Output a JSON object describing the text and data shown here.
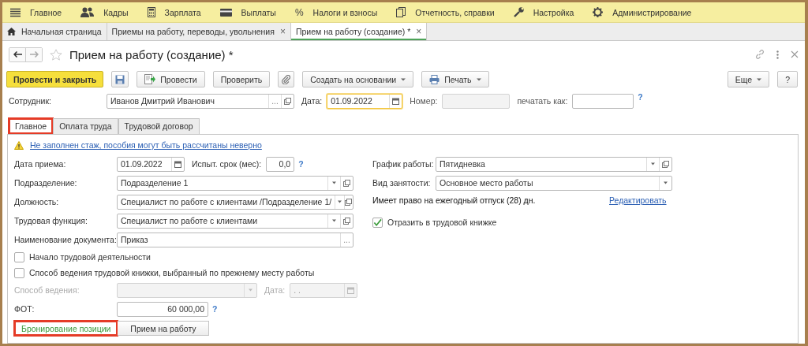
{
  "menu": [
    {
      "kind": "menu",
      "label": "Главное"
    },
    {
      "kind": "people",
      "label": "Кадры"
    },
    {
      "kind": "calculator",
      "label": "Зарплата"
    },
    {
      "kind": "card",
      "label": "Выплаты"
    },
    {
      "kind": "glyph",
      "glyph": "%",
      "label": "Налоги и взносы"
    },
    {
      "kind": "docs",
      "label": "Отчетность, справки"
    },
    {
      "kind": "wrench",
      "label": "Настройка"
    },
    {
      "kind": "gear",
      "label": "Администрирование"
    }
  ],
  "open_tabs": [
    {
      "kind": "home",
      "label": "Начальная страница",
      "selected": false,
      "closable": false
    },
    {
      "kind": "page",
      "label": "Приемы на работу, переводы, увольнения",
      "selected": false,
      "closable": true,
      "close": "×"
    },
    {
      "kind": "page",
      "label": "Прием на работу (создание) *",
      "selected": true,
      "closable": true,
      "close": "×"
    }
  ],
  "form": {
    "title": "Прием на работу (создание) *"
  },
  "toolbar": [
    {
      "kind": "primary",
      "label": "Провести и закрыть"
    },
    {
      "kind": "save"
    },
    {
      "kind": "post",
      "label": "Провести"
    },
    {
      "kind": "text",
      "label": "Проверить"
    },
    {
      "kind": "clip"
    },
    {
      "kind": "dropdown",
      "label": "Создать на основании"
    },
    {
      "kind": "print",
      "label": "Печать"
    }
  ],
  "toolbar_right": [
    {
      "kind": "dropdown",
      "label": "Еще"
    },
    {
      "kind": "text",
      "label": "?"
    }
  ],
  "header": {
    "employee": {
      "label": "Сотрудник:",
      "value": "Иванов Дмитрий Иванович",
      "buttons": [
        {
          "kind": "choose",
          "text": "..."
        },
        {
          "kind": "open"
        }
      ]
    },
    "date": {
      "label": "Дата:",
      "value": "01.09.2022",
      "focused": true,
      "buttons": [
        {
          "kind": "calendar"
        }
      ]
    },
    "number": {
      "label": "Номер:",
      "disabled": true
    },
    "print_as": {
      "label": "печатать как:"
    },
    "help": "?"
  },
  "tabs": [
    {
      "label": "Главное",
      "selected": true,
      "highlighted": true
    },
    {
      "label": "Оплата труда",
      "selected": false,
      "highlighted": false
    },
    {
      "label": "Трудовой договор",
      "selected": false,
      "highlighted": false
    }
  ],
  "warning": "Не заполнен стаж, пособия могут быть рассчитаны неверно",
  "left": [
    {
      "kind": "date",
      "label": "Дата приема:",
      "value": "01.09.2022",
      "disabled": false,
      "buttons": [
        {
          "kind": "calendar"
        }
      ],
      "second": {
        "kind": "number",
        "label": "Испыт. срок (мес):",
        "value": "0,0",
        "disabled": false,
        "help": "?"
      }
    },
    {
      "kind": "wide",
      "label": "Подразделение:",
      "value": "Подразделение 1",
      "disabled": false,
      "buttons": [
        {
          "kind": "dropdown"
        },
        {
          "kind": "open"
        }
      ]
    },
    {
      "kind": "wide",
      "label": "Должность:",
      "value": "Специалист по работе с клиентами /Подразделение 1/",
      "disabled": false,
      "buttons": [
        {
          "kind": "dropdown"
        },
        {
          "kind": "open"
        }
      ]
    },
    {
      "kind": "wide",
      "label": "Трудовая функция:",
      "value": "Специалист по работе с клиентами",
      "disabled": false,
      "buttons": [
        {
          "kind": "dropdown"
        },
        {
          "kind": "open"
        }
      ]
    },
    {
      "kind": "wide",
      "label": "Наименование документа:",
      "value": "Приказ",
      "disabled": false,
      "buttons": [
        {
          "kind": "choose",
          "text": "..."
        }
      ]
    },
    {
      "kind": "checkbox",
      "label": "Начало трудовой деятельности",
      "checked": false
    },
    {
      "kind": "checkbox",
      "label": "Способ ведения трудовой книжки, выбранный по прежнему месту работы",
      "checked": false
    },
    {
      "kind": "medium",
      "label": "Способ ведения:",
      "disabled": true,
      "buttons": [
        {
          "kind": "dropdown"
        }
      ],
      "second": {
        "kind": "date",
        "label": "Дата:",
        "placeholder": ". .",
        "disabled": true,
        "buttons": [
          {
            "kind": "calendar"
          }
        ]
      }
    },
    {
      "kind": "money",
      "label": "ФОТ:",
      "value": "60 000,00",
      "disabled": false,
      "help": "?"
    },
    {
      "kind": "switch",
      "options": [
        {
          "label": "Бронирование позиции",
          "selected": true,
          "highlighted": true
        },
        {
          "label": "Прием на работу",
          "selected": false,
          "highlighted": false
        }
      ]
    }
  ],
  "right": [
    {
      "kind": "wide",
      "label": "График работы:",
      "value": "Пятидневка",
      "disabled": false,
      "buttons": [
        {
          "kind": "dropdown"
        },
        {
          "kind": "open"
        }
      ]
    },
    {
      "kind": "wide",
      "label": "Вид занятости:",
      "value": "Основное место работы",
      "disabled": false,
      "buttons": [
        {
          "kind": "dropdown"
        }
      ]
    },
    {
      "kind": "note",
      "text": "Имеет право на ежегодный отпуск (28) дн.",
      "link": "Редактировать"
    },
    {
      "kind": "checkbox",
      "label": "Отразить в трудовой книжке",
      "checked": true
    }
  ]
}
